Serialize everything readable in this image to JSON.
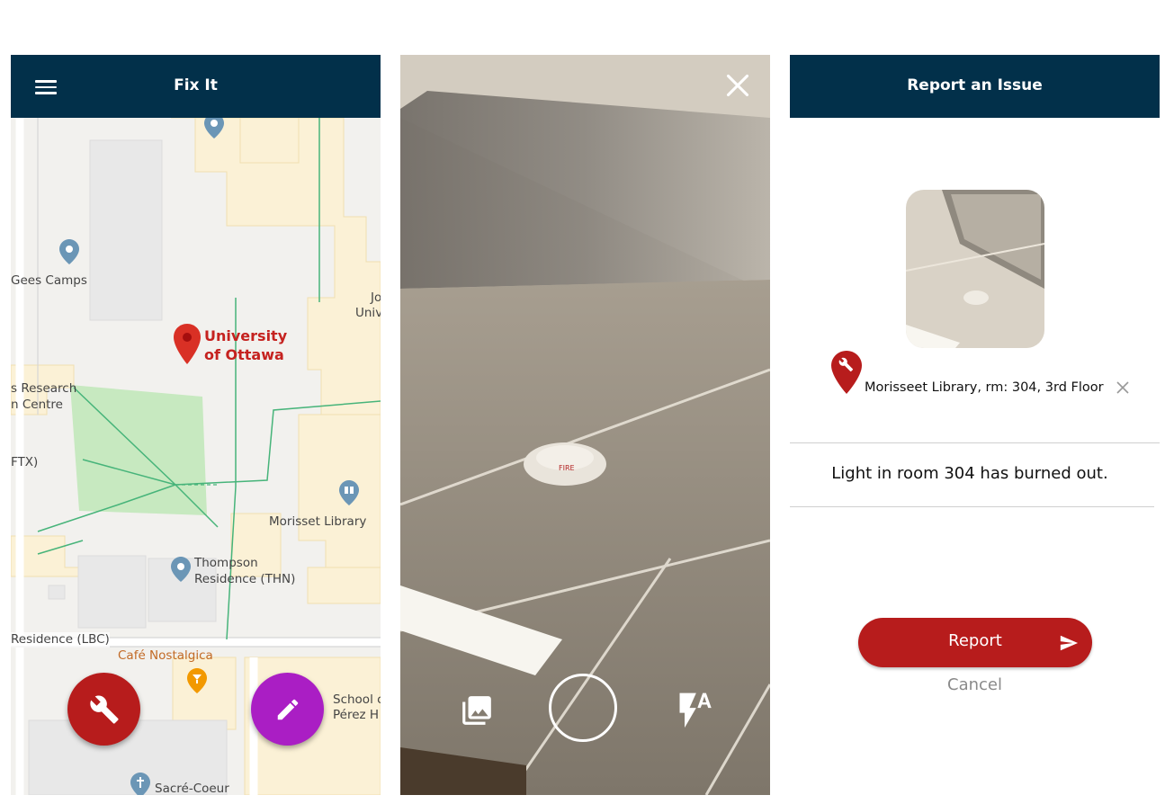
{
  "map_screen": {
    "title": "Fix It",
    "labels": {
      "gees_camps": "Gees Camps",
      "university_line1": "University",
      "university_line2": "of Ottawa",
      "research_line1": "s Research",
      "research_line2": "n Centre",
      "ftx": "FTX)",
      "jo": "Jo",
      "univ": "Univ",
      "morisset": "Morisset Library",
      "thompson_line1": "Thompson",
      "thompson_line2": "Residence (THN)",
      "residence_lbc": "Residence (LBC)",
      "cafe": "Café Nostalgica",
      "school_line1": "School c",
      "school_line2": "Pérez H",
      "sacre_coeur": "Sacré-Coeur"
    },
    "colors": {
      "header": "#02304a",
      "fab_fix": "#b71c1c",
      "fab_edit": "#aa1ec4",
      "university_label": "#c5221f"
    }
  },
  "camera_screen": {
    "fire_sign": "FIRE"
  },
  "report_screen": {
    "title": "Report an Issue",
    "location": "Morisseet Library, rm: 304, 3rd Floor",
    "description": "Light in room 304 has burned out.",
    "report_label": "Report",
    "cancel_label": "Cancel"
  }
}
